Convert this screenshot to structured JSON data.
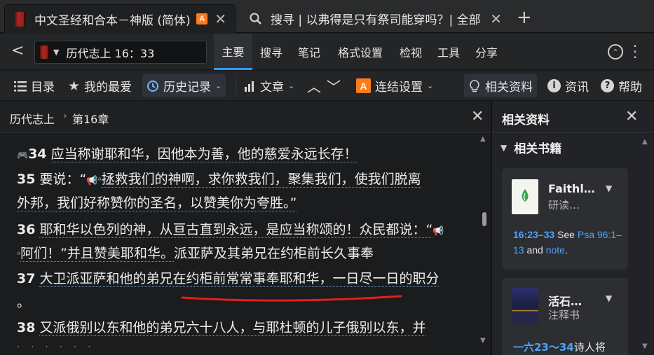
{
  "tabs": [
    {
      "label": "中文圣经和合本－神版 (简体)",
      "badge": "A"
    },
    {
      "label": "搜寻 | 以弗得是只有祭司能穿吗？| 全部"
    }
  ],
  "nav": {
    "reference": "历代志上 16：33",
    "menu": [
      "主要",
      "搜寻",
      "笔记",
      "格式设置",
      "检视",
      "工具",
      "分享"
    ]
  },
  "toolbar": {
    "contents": "目录",
    "favorites": "我的最爱",
    "history": "历史记录",
    "articles": "文章",
    "link_badge": "A",
    "link_settings": "连结设置",
    "related": "相关资料",
    "info": "资讯",
    "help": "帮助"
  },
  "breadcrumb": {
    "book": "历代志上",
    "chapter": "第16章"
  },
  "verses": {
    "v34_num": "34",
    "v34_text": "应当称谢耶和华，因他本为善，他的慈爱永远长存！",
    "v35_num": "35",
    "v35_a": "要说：“",
    "v35_b": "拯救我们的神啊，求你救我们，聚集我们，使我们脱离",
    "v35_c": "外邦，我们好称赞你的圣名，以赞美你为夸胜。”",
    "v36_num": "36",
    "v36_a": "耶和华以色列的神，从亘古直到永远，是应当称颂的！众民都说：“",
    "v36_b": "阿们！”并且赞美耶和华。",
    "v36_highlight": "派亚萨及其弟兄在约柜前长久事奉",
    "v37_num": "37",
    "v37_a": "大卫派亚萨和他的弟兄在约柜前常常事奉耶和华，一日尽一日的职分",
    "v37_b": "。",
    "v38_num": "38",
    "v38_a": "又派俄别以东和他的弟兄六十八人，与耶杜顿的儿子俄别以东，并"
  },
  "side": {
    "title": "相关资料",
    "section": "相关书籍",
    "card1": {
      "title": "Faithl…",
      "sub": "研读…",
      "ref": "16:23–33",
      "see": " See ",
      "ref2": "Psa 96:1–13",
      "and": " and ",
      "note": "note",
      "end": "."
    },
    "card2": {
      "title": "活石…",
      "sub": "注释书",
      "ref": "一六23〜34",
      "desc": "诗人将"
    }
  },
  "colors": {
    "accent": "#2e9bf0",
    "link": "#4da3ff",
    "highlight_underline": "#e0201c",
    "badge": "#ff7a1a"
  }
}
